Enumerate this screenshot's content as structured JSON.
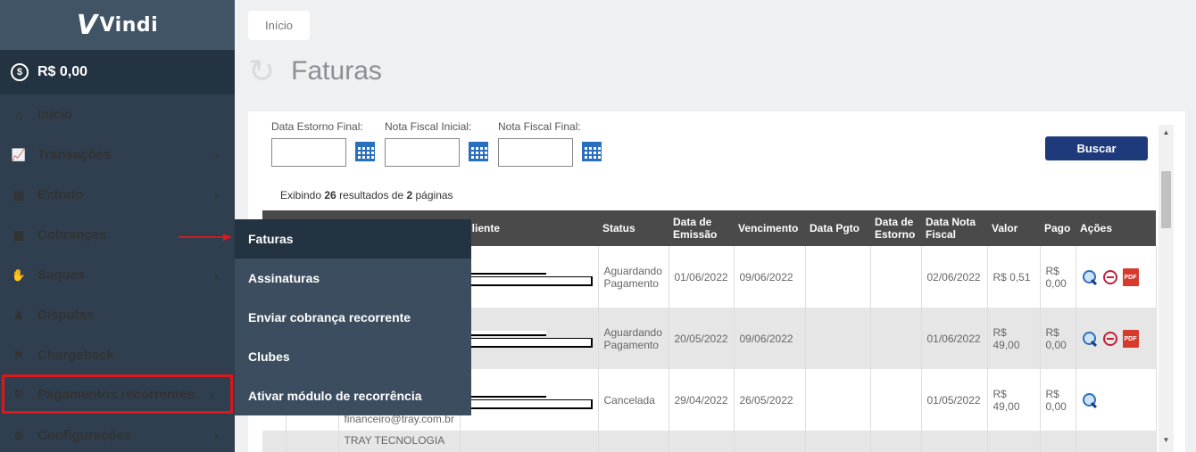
{
  "sidebar": {
    "logo": "Vindi",
    "balance": "R$ 0,00",
    "items": [
      {
        "label": "Início"
      },
      {
        "label": "Transações"
      },
      {
        "label": "Extrato"
      },
      {
        "label": "Cobranças"
      },
      {
        "label": "Saques"
      },
      {
        "label": "Disputas"
      },
      {
        "label": "Chargeback"
      },
      {
        "label": "Pagamentos recorrentes"
      },
      {
        "label": "Configurações"
      }
    ]
  },
  "submenu": {
    "items": [
      {
        "label": "Faturas"
      },
      {
        "label": "Assinaturas"
      },
      {
        "label": "Enviar cobrança recorrente"
      },
      {
        "label": "Clubes"
      },
      {
        "label": "Ativar módulo de recorrência"
      }
    ]
  },
  "breadcrumb": "Início",
  "page_title": "Faturas",
  "filters": {
    "labels": [
      "Data Estorno Final:",
      "Nota Fiscal Inicial:",
      "Nota Fiscal Final:"
    ],
    "search_button": "Buscar"
  },
  "results": {
    "prefix": "Exibindo",
    "count": "26",
    "middle": "resultados de",
    "pages": "2",
    "suffix": "páginas"
  },
  "table": {
    "headers": [
      "Cliente",
      "Status",
      "Data de Emissão",
      "Vencimento",
      "Data Pgto",
      "Data de Estorno",
      "Data Nota Fiscal",
      "Valor",
      "Pago",
      "Ações"
    ],
    "rows": [
      {
        "status": "Aguardando Pagamento",
        "emissao": "01/06/2022",
        "vencimento": "09/06/2022",
        "pgto": "",
        "estorno": "",
        "nota": "02/06/2022",
        "valor": "R$ 0,51",
        "pago": "R$ 0,00",
        "actions": [
          "view",
          "cancel",
          "pdf"
        ]
      },
      {
        "status": "Aguardando Pagamento",
        "emissao": "20/05/2022",
        "vencimento": "09/06/2022",
        "pgto": "",
        "estorno": "",
        "nota": "01/06/2022",
        "valor": "R$ 49,00",
        "pago": "R$ 0,00",
        "actions": [
          "view",
          "cancel",
          "pdf"
        ]
      },
      {
        "status": "Cancelada",
        "emissao": "29/04/2022",
        "vencimento": "26/05/2022",
        "pgto": "",
        "estorno": "",
        "nota": "01/05/2022",
        "valor": "R$ 49,00",
        "pago": "R$ 0,00",
        "actions": [
          "view"
        ],
        "email": "financeiro@tray.com.br"
      },
      {
        "company": "TRAY TECNOLOGIA"
      }
    ]
  },
  "icons": {
    "view": "magnifier-icon",
    "cancel": "cancel-icon",
    "pdf": "pdf-icon"
  },
  "colors": {
    "sidebar": "#2f3f4f",
    "submenu": "#3c4d5f",
    "accent": "#1e3a7a",
    "highlight": "#d9191c"
  }
}
